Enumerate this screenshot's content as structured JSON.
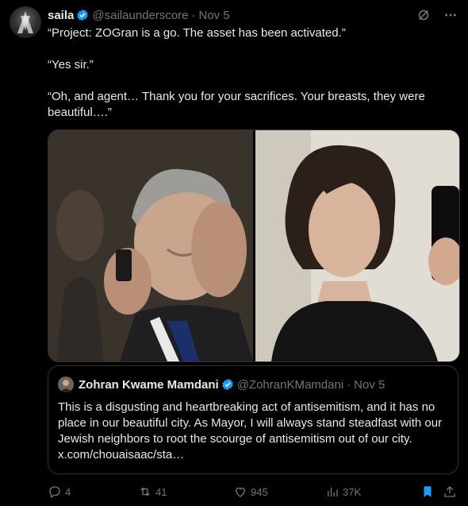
{
  "author": {
    "name": "saila",
    "handle": "@sailaunderscore",
    "date": "Nov 5"
  },
  "tweet": {
    "paragraphs": [
      "“Project: ZOGran is a go. The asset has been activated.”",
      "“Yes sir.”",
      "“Oh, and agent… Thank you for your sacrifices. Your breasts, they were beautiful….”"
    ]
  },
  "quote": {
    "name": "Zohran Kwame Mamdani",
    "handle": "@ZohranKMamdani",
    "date": "Nov 5",
    "text": "This is a disgusting and heartbreaking act of antisemitism, and it has no place in our beautiful city. As Mayor, I will always stand steadfast with our Jewish neighbors to root the scourge of antisemitism out of our city.",
    "link": "x.com/chouaisaac/sta…"
  },
  "actions": {
    "replies": "4",
    "reposts": "41",
    "likes": "945",
    "views": "37K"
  },
  "colors": {
    "background": "#000000",
    "text": "#e7e9ea",
    "muted": "#71767b",
    "verified": "#1d9bf0",
    "bookmark": "#1d9bf0"
  },
  "icons": [
    "verified-badge-icon",
    "grok-icon",
    "more-icon",
    "reply-icon",
    "repost-icon",
    "like-icon",
    "views-icon",
    "bookmark-icon",
    "share-icon"
  ]
}
